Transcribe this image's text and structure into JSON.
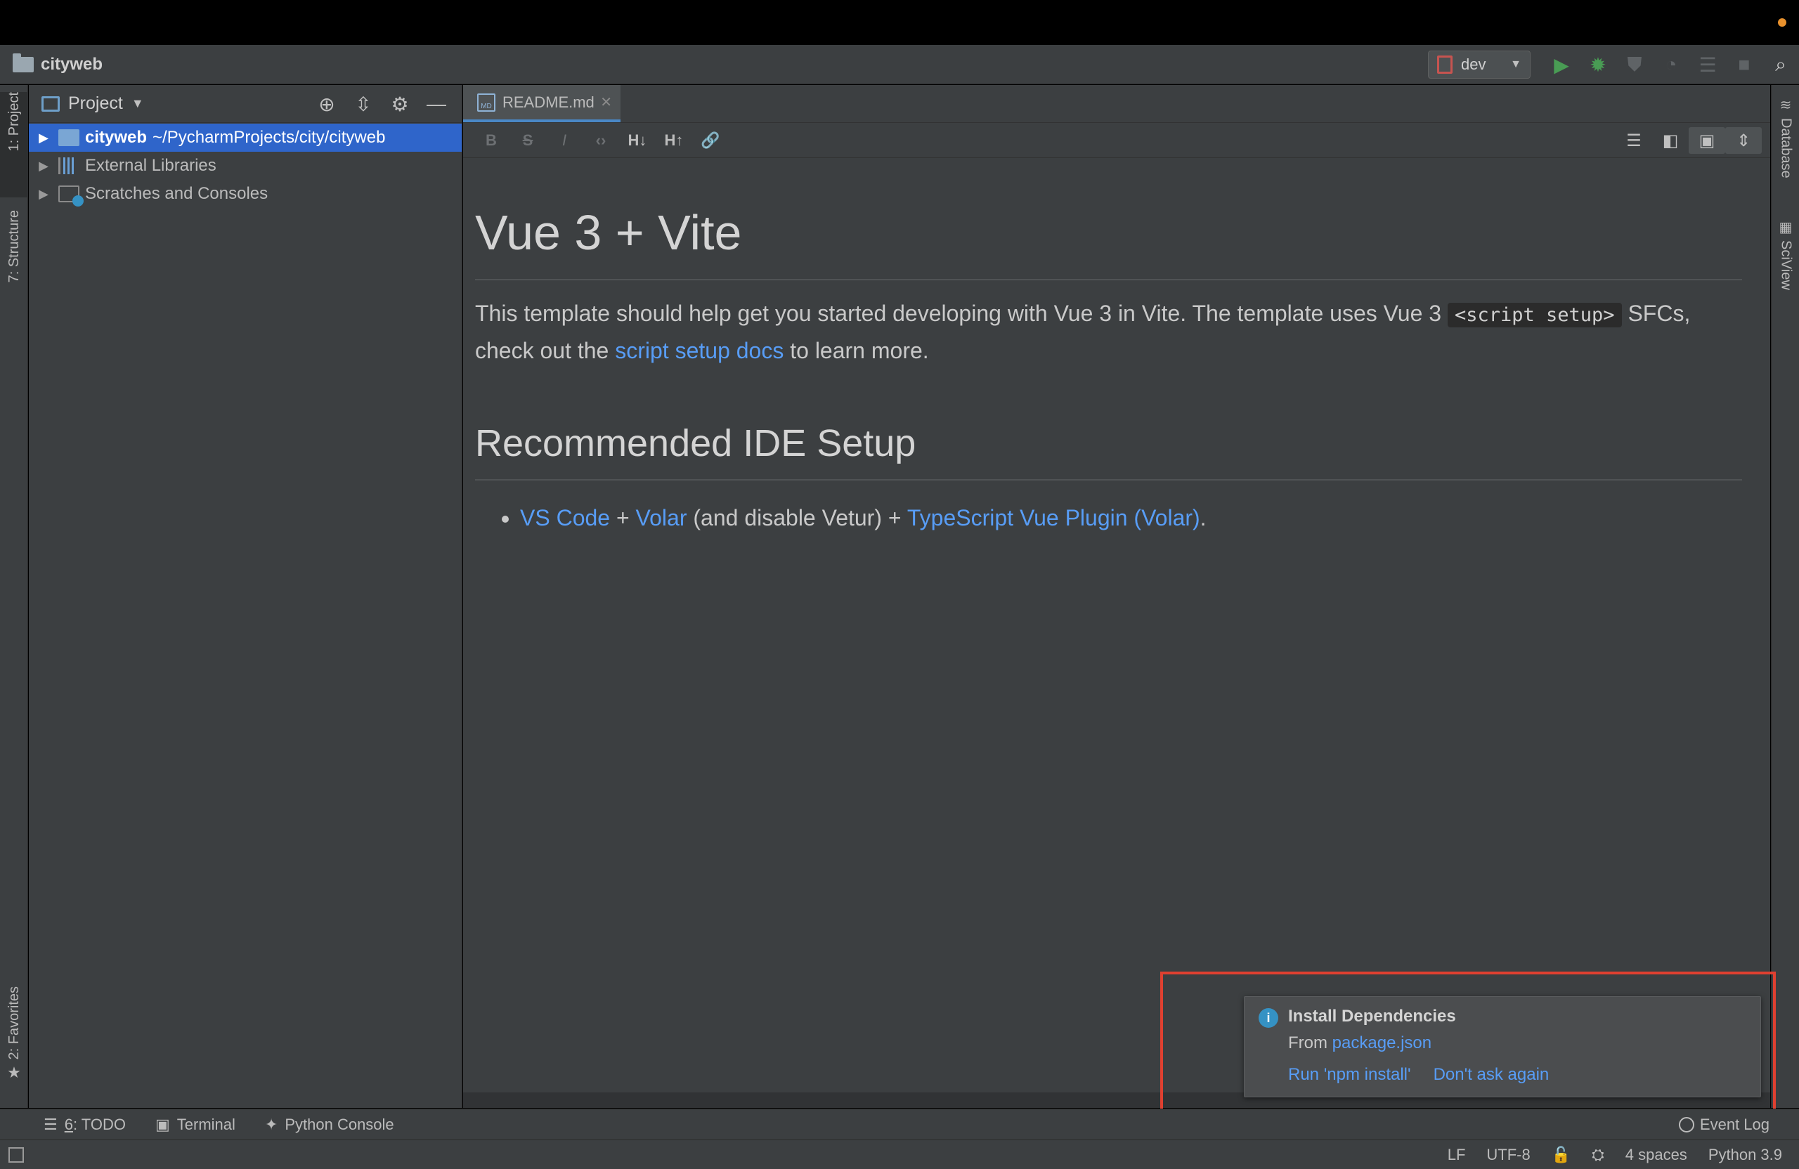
{
  "window": {
    "project_name": "cityweb"
  },
  "toolbar": {
    "run_config": "dev",
    "icons": [
      "run-icon",
      "debug-icon",
      "coverage-icon",
      "profile-icon",
      "build-icon",
      "stop-icon",
      "search-icon"
    ]
  },
  "left_tabs": {
    "project": "1: Project",
    "structure": "7: Structure",
    "favorites": "2: Favorites"
  },
  "right_tabs": {
    "database": "Database",
    "sciview": "SciView"
  },
  "project_panel": {
    "title": "Project",
    "tree": [
      {
        "name": "cityweb",
        "path": "~/PycharmProjects/city/cityweb",
        "selected": true
      },
      {
        "name": "External Libraries"
      },
      {
        "name": "Scratches and Consoles"
      }
    ]
  },
  "editor": {
    "tab_label": "README.md",
    "md_toolbar": [
      "B",
      "S",
      "I",
      "<>",
      "H↓",
      "H↑",
      "link"
    ],
    "preview": {
      "h1": "Vue 3 + Vite",
      "p1_a": "This template should help get you started developing with Vue 3 in Vite. The template uses Vue 3 ",
      "p1_code": "<script setup>",
      "p1_b": " SFCs, check out the ",
      "p1_link": "script setup docs",
      "p1_c": " to learn more.",
      "h2": "Recommended IDE Setup",
      "li_link1": "VS Code",
      "li_plus1": " + ",
      "li_link2": "Volar",
      "li_text": " (and disable Vetur) + ",
      "li_link3": "TypeScript Vue Plugin (Volar)",
      "li_end": "."
    }
  },
  "notification": {
    "title": "Install Dependencies",
    "from_label": "From",
    "from_link": "package.json",
    "action_run": "Run 'npm install'",
    "action_dismiss": "Don't ask again"
  },
  "tool_windows": {
    "todo_num": "6",
    "todo_label": ": TODO",
    "terminal": "Terminal",
    "python_console": "Python Console",
    "event_log": "Event Log"
  },
  "status": {
    "line_sep": "LF",
    "encoding": "UTF-8",
    "indent": "4 spaces",
    "interpreter": "Python 3.9"
  },
  "colors": {
    "accent": "#2f65ca",
    "link": "#589df6",
    "highlight_box": "#e04030",
    "run_green": "#499c54"
  }
}
